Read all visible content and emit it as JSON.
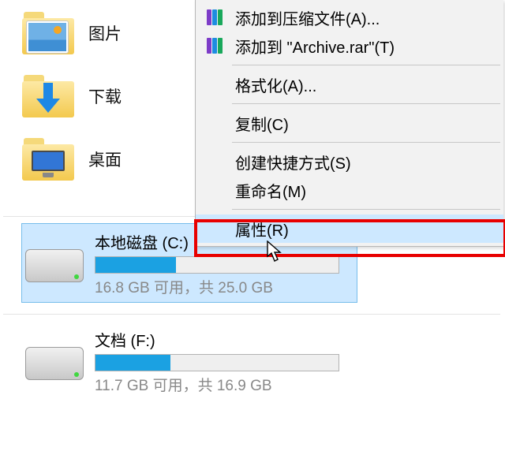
{
  "folders": [
    {
      "label": "图片",
      "icon": "pictures"
    },
    {
      "label": "下载",
      "icon": "downloads"
    },
    {
      "label": "桌面",
      "icon": "desktop"
    }
  ],
  "drives": [
    {
      "name": "本地磁盘 (C:)",
      "free_text": "16.8 GB 可用，共 25.0 GB",
      "used_pct": 33,
      "selected": true
    },
    {
      "name": "文档 (F:)",
      "free_text": "11.7 GB 可用，共 16.9 GB",
      "used_pct": 31,
      "selected": false
    }
  ],
  "context_menu": {
    "items": [
      {
        "label": "添加到压缩文件(A)...",
        "icon": "rar",
        "sep_after": false
      },
      {
        "label": "添加到 \"Archive.rar\"(T)",
        "icon": "rar",
        "sep_after": true
      },
      {
        "label": "格式化(A)...",
        "icon": "none",
        "sep_after": true
      },
      {
        "label": "复制(C)",
        "icon": "none",
        "sep_after": true
      },
      {
        "label": "创建快捷方式(S)",
        "icon": "none",
        "sep_after": false
      },
      {
        "label": "重命名(M)",
        "icon": "none",
        "sep_after": true
      },
      {
        "label": "属性(R)",
        "icon": "none",
        "sep_after": false,
        "highlight": true
      }
    ]
  }
}
